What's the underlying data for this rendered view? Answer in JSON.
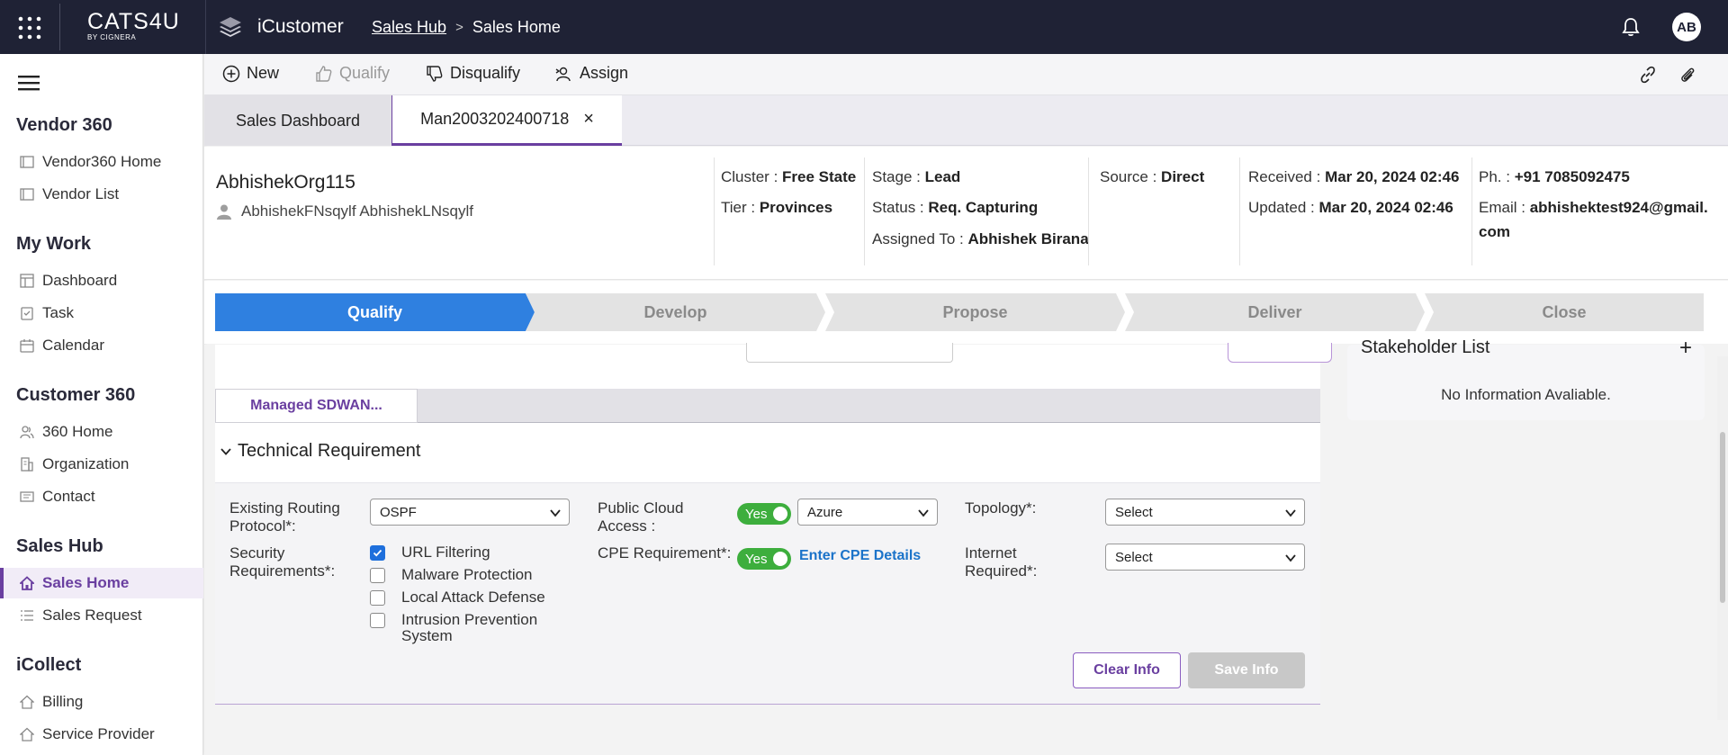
{
  "topbar": {
    "logo_main": "CATS4U",
    "logo_sub": "BY CIGNERA",
    "app_name": "iCustomer",
    "breadcrumb": [
      "Sales Hub",
      "Sales Home"
    ],
    "breadcrumb_sep": ">",
    "avatar": "AB"
  },
  "sidebar": {
    "sections": [
      {
        "title": "Vendor 360",
        "items": [
          {
            "label": "Vendor360 Home",
            "icon": "window-icon"
          },
          {
            "label": "Vendor List",
            "icon": "window-icon"
          }
        ]
      },
      {
        "title": "My Work",
        "items": [
          {
            "label": "Dashboard",
            "icon": "dashboard-icon"
          },
          {
            "label": "Task",
            "icon": "task-icon"
          },
          {
            "label": "Calendar",
            "icon": "calendar-icon"
          }
        ]
      },
      {
        "title": "Customer 360",
        "items": [
          {
            "label": "360 Home",
            "icon": "users-icon"
          },
          {
            "label": "Organization",
            "icon": "building-icon"
          },
          {
            "label": "Contact",
            "icon": "contact-card-icon"
          }
        ]
      },
      {
        "title": "Sales Hub",
        "items": [
          {
            "label": "Sales Home",
            "icon": "home-icon",
            "active": true
          },
          {
            "label": "Sales Request",
            "icon": "list-icon"
          }
        ]
      },
      {
        "title": "iCollect",
        "items": [
          {
            "label": "Billing",
            "icon": "home-icon"
          },
          {
            "label": "Service Provider",
            "icon": "home-icon"
          }
        ]
      }
    ]
  },
  "toolbar": {
    "new": "New",
    "qualify": "Qualify",
    "disqualify": "Disqualify",
    "assign": "Assign"
  },
  "tabs": {
    "tab1": "Sales Dashboard",
    "tab2": "Man2003202400718"
  },
  "header": {
    "org": "AbhishekOrg115",
    "person": "AbhishekFNsqylf AbhishekLNsqylf",
    "cluster_label": "Cluster :",
    "cluster": "Free State",
    "tier_label": "Tier :",
    "tier": "Provinces",
    "stage_label": "Stage :",
    "stage": "Lead",
    "status_label": "Status :",
    "status": "Req. Capturing",
    "assigned_label": "Assigned To :",
    "assigned": "Abhishek Birana",
    "source_label": "Source :",
    "source": "Direct",
    "received_label": "Received :",
    "received": "Mar 20, 2024 02:46",
    "updated_label": "Updated :",
    "updated": "Mar 20, 2024 02:46",
    "phone_label": "Ph. :",
    "phone": "+91 7085092475",
    "email_label": "Email :",
    "email_line1": "abhishektest924@gmail.",
    "email_line2": "com"
  },
  "stages": [
    "Qualify",
    "Develop",
    "Propose",
    "Deliver",
    "Close"
  ],
  "colors": {
    "active_stage": "#2f80e0",
    "inactive_stage": "#e3e3e3",
    "accent": "#6a3fa0",
    "toggle_on": "#3dae3d",
    "link": "#1b73c9"
  },
  "content": {
    "subtab": "Managed SDWAN...",
    "section_title": "Technical Requirement",
    "routing_label_1": "Existing Routing",
    "routing_label_2": "Protocol*:",
    "routing_value": "OSPF",
    "cloud_label_1": "Public Cloud",
    "cloud_label_2": "Access :",
    "cloud_toggle": "Yes",
    "cloud_value": "Azure",
    "topology_label": "Topology*:",
    "topology_value": "Select",
    "security_label_1": "Security",
    "security_label_2": "Requirements*:",
    "security_options": [
      {
        "label": "URL Filtering",
        "checked": true
      },
      {
        "label": "Malware Protection",
        "checked": false
      },
      {
        "label": "Local Attack Defense",
        "checked": false
      },
      {
        "label": "Intrusion Prevention System",
        "checked": false
      }
    ],
    "cpe_label": "CPE Requirement*:",
    "cpe_toggle": "Yes",
    "cpe_link": "Enter CPE Details",
    "internet_label_1": "Internet",
    "internet_label_2": "Required*:",
    "internet_value": "Select",
    "clear_btn": "Clear Info",
    "save_btn": "Save Info"
  },
  "stakeholder": {
    "title": "Stakeholder List",
    "plus": "+",
    "empty": "No Information Avaliable."
  }
}
